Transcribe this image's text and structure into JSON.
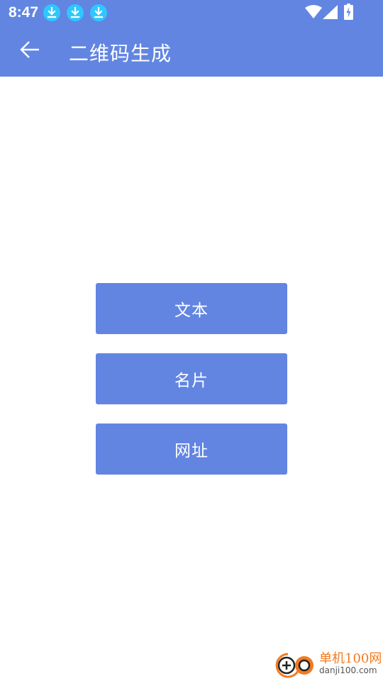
{
  "status_bar": {
    "time": "8:47",
    "notification_icons": [
      "download-icon",
      "download-icon",
      "download-icon"
    ],
    "system_icons": [
      "wifi-icon",
      "cell-signal-icon",
      "battery-charging-icon"
    ]
  },
  "toolbar": {
    "back_icon": "arrow-left-icon",
    "title": "二维码生成"
  },
  "buttons": {
    "text": "文本",
    "card": "名片",
    "url": "网址"
  },
  "watermark": {
    "name": "单机100网",
    "url": "danji100.com"
  },
  "colors": {
    "primary": "#6285e2",
    "background": "#ffffff",
    "download_badge": "#2ec7ff",
    "watermark_orange": "#f27b22"
  }
}
